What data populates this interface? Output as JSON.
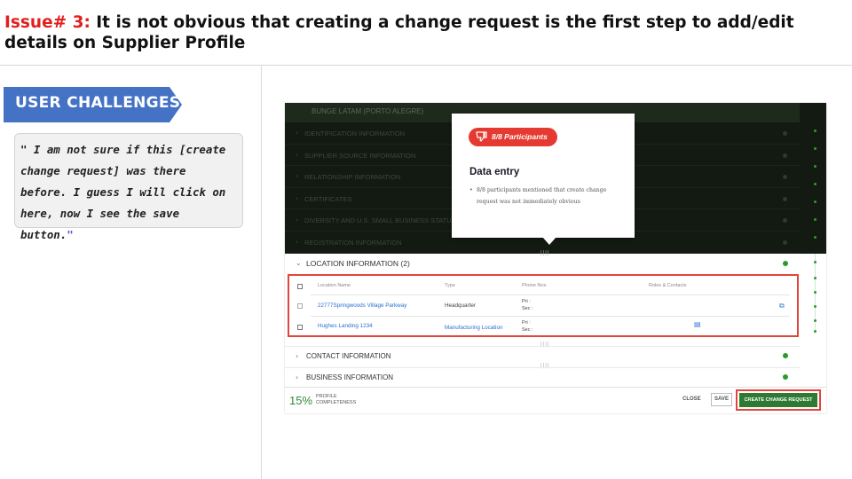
{
  "title": {
    "issue_label": "Issue# 3:",
    "text": " It is not obvious that creating a change request is the first step to add/edit details on Supplier Profile"
  },
  "left_panel": {
    "banner_label": "USER CHALLENGES",
    "quote_open": "\" I am not sure if this [create change request] was there before. I guess I will click on here, now I see the save button.",
    "quote_close": "\""
  },
  "screenshot": {
    "topbar_text": "BUNGE LATAM (PORTO ALEGRE)",
    "dim_sections": [
      "IDENTIFICATION INFORMATION",
      "SUPPLIER SOURCE INFORMATION",
      "RELATIONSHIP INFORMATION",
      "CERTIFICATES",
      "DIVERSITY AND U.S. SMALL BUSINESS STATUS",
      "REGISTRATION INFORMATION"
    ],
    "popup": {
      "pill_label": "8/8 Participants",
      "heading": "Data entry",
      "bullet": "•",
      "body": "8/8 participants mentioned that create change request was not immediately obvious"
    },
    "location": {
      "header": "LOCATION INFORMATION (2)",
      "columns": [
        "Location Name",
        "Type",
        "Phone Nos.",
        "Roles & Contacts"
      ],
      "rows": [
        {
          "name": "22777Springwoods Village Parkway",
          "type": "Headquarter",
          "phone_pri": "Pri :",
          "phone_sec": "Sec :"
        },
        {
          "name": "Hughes Landing 1234",
          "type": "Manufacturing Location",
          "phone_pri": "Pri :",
          "phone_sec": "Sec :"
        }
      ]
    },
    "sections_below": [
      "CONTACT INFORMATION",
      "BUSINESS INFORMATION"
    ],
    "drag_handle": "||||",
    "bottom": {
      "percent": "15%",
      "profile_label": "PROFILE",
      "completeness_label": "COMPLETENESS",
      "close_label": "CLOSE",
      "save_label": "SAVE",
      "create_label": "CREATE CHANGE REQUEST"
    }
  },
  "colors": {
    "accent_red": "#e0201e",
    "banner_blue": "#4472c4",
    "highlight_red": "#e2453b",
    "primary_green": "#2f7a32"
  }
}
